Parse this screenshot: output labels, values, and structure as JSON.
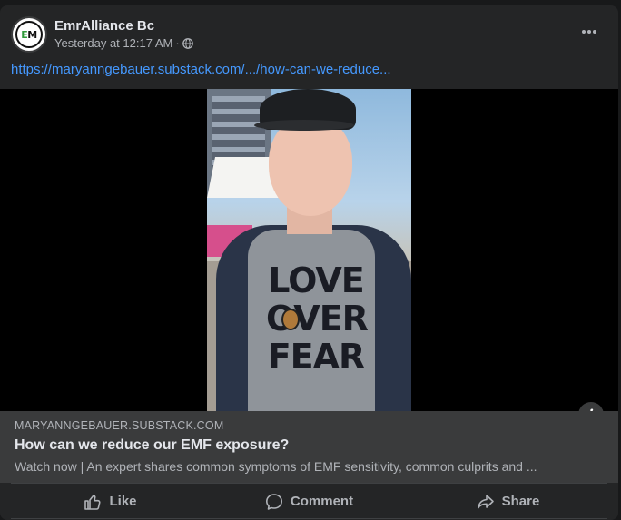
{
  "post": {
    "author": "EmrAlliance Bc",
    "timestamp": "Yesterday at 12:17 AM",
    "link_text": "https://maryanngebauer.substack.com/.../how-can-we-reduce...",
    "avatar_letters": "EM"
  },
  "video": {
    "shirt_text": "LOVE OVER FEAR"
  },
  "preview": {
    "domain": "MARYANNGEBAUER.SUBSTACK.COM",
    "title": "How can we reduce our EMF exposure?",
    "description": "Watch now | An expert shares common symptoms of EMF sensitivity, common culprits and ..."
  },
  "actions": {
    "like": "Like",
    "comment": "Comment",
    "share": "Share"
  },
  "icons": {
    "globe": "globe-icon",
    "more": "more-icon",
    "info": "info-icon",
    "like": "thumbs-up-icon",
    "comment": "comment-bubble-icon",
    "share": "share-arrow-icon"
  },
  "colors": {
    "link": "#4599ff",
    "card": "#242526",
    "preview_bg": "#3a3b3c"
  }
}
